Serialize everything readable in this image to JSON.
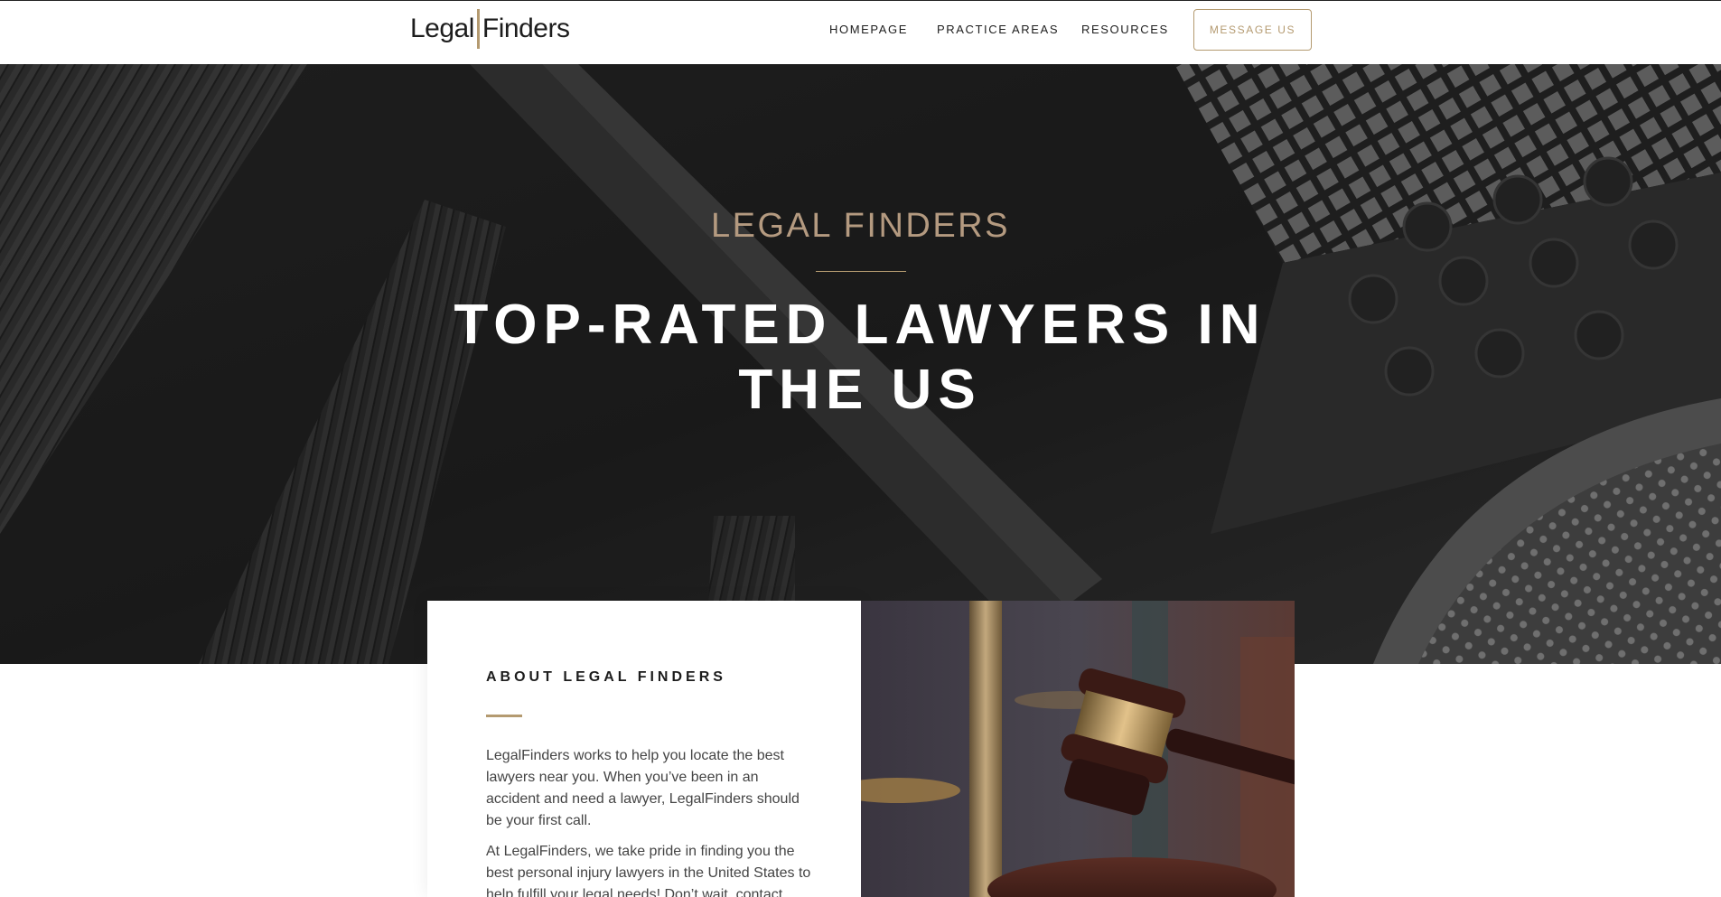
{
  "header": {
    "logo_left": "Legal",
    "logo_right": "Finders",
    "nav": [
      {
        "label": "HOMEPAGE"
      },
      {
        "label": "PRACTICE AREAS"
      },
      {
        "label": "RESOURCES"
      }
    ],
    "message_button": "MESSAGE US"
  },
  "hero": {
    "eyebrow": "LEGAL FINDERS",
    "title_line1": "TOP-RATED LAWYERS IN",
    "title_line2": "THE US"
  },
  "about": {
    "heading": "ABOUT LEGAL FINDERS",
    "paragraph1": "LegalFinders works to help you locate the best lawyers near you. When you’ve been in an accident and need a lawyer, LegalFinders should be your first call.",
    "paragraph2": "At LegalFinders, we take pride in finding you the best personal injury lawyers in the United States to help fulfill your legal needs! Don’t wait, contact"
  },
  "colors": {
    "accent": "#b49a70",
    "hero_bg": "#2c2c2c",
    "text_dark": "#1d1d1d"
  },
  "icons": {
    "gavel_image": "gavel-image",
    "hero_background": "courthouse-columns-image"
  }
}
